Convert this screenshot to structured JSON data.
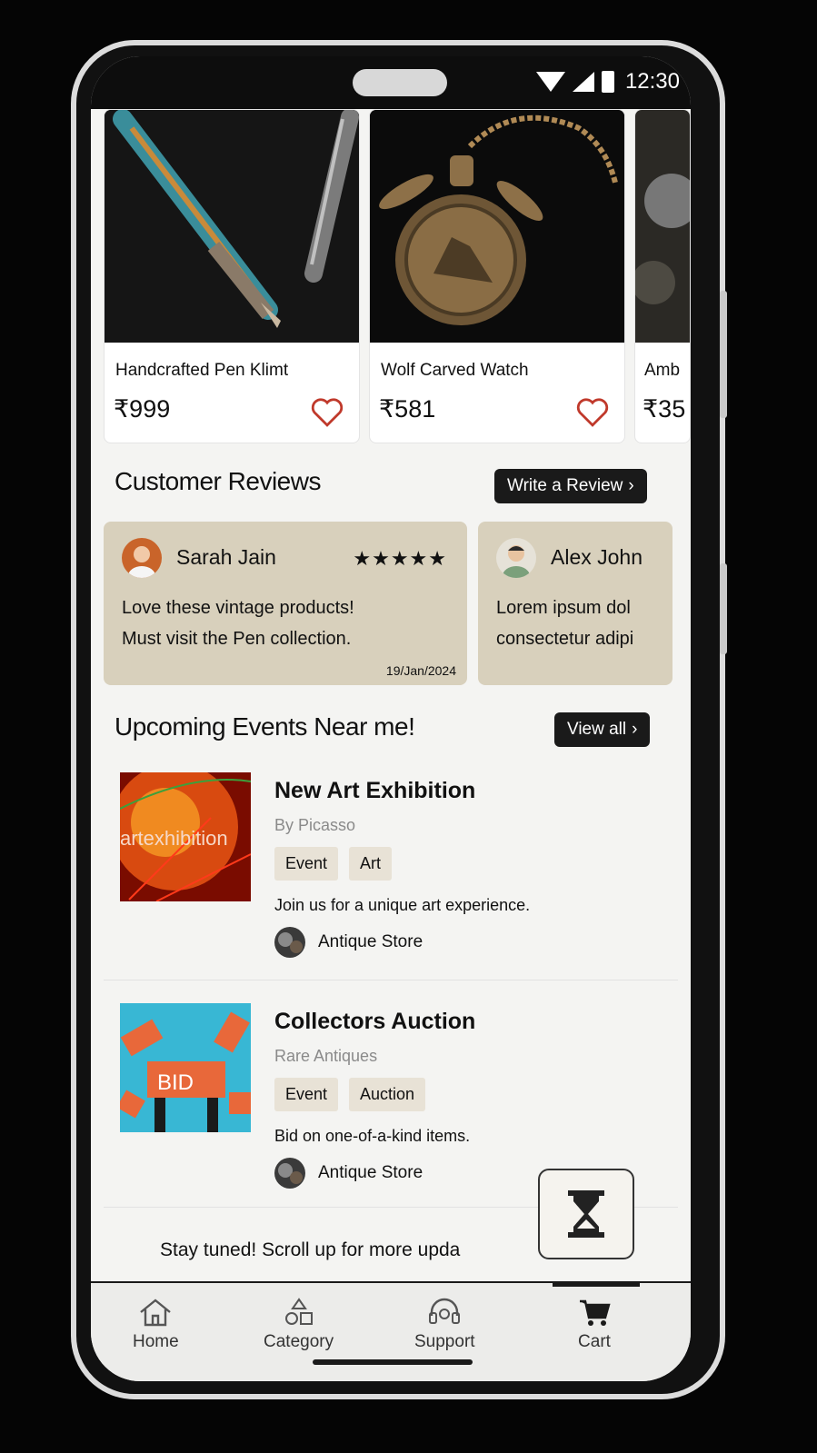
{
  "status": {
    "time": "12:30"
  },
  "products": [
    {
      "name": "Handcrafted Pen Klimt",
      "price": "₹999"
    },
    {
      "name": "Wolf Carved Watch",
      "price": "₹581"
    },
    {
      "name": "Amb",
      "price": "₹35"
    }
  ],
  "reviews_section": {
    "title": "Customer Reviews",
    "button": "Write a Review",
    "items": [
      {
        "name": "Sarah Jain",
        "stars": "★★★★★",
        "line1": "Love these vintage products!",
        "line2": "Must visit the Pen collection.",
        "date": "19/Jan/2024"
      },
      {
        "name": "Alex John",
        "line1": "Lorem ipsum dol",
        "line2": "consectetur adipi"
      }
    ]
  },
  "events_section": {
    "title": "Upcoming Events Near me!",
    "button": "View all",
    "items": [
      {
        "title": "New Art Exhibition",
        "subtitle": "By Picasso",
        "tags": [
          "Event",
          "Art"
        ],
        "description": "Join us for a unique art experience.",
        "store": "Antique Store",
        "image_text": "artexhibition"
      },
      {
        "title": "Collectors Auction",
        "subtitle": "Rare Antiques",
        "tags": [
          "Event",
          "Auction"
        ],
        "description": "Bid on one-of-a-kind items.",
        "store": "Antique Store",
        "image_text": "BID"
      }
    ]
  },
  "footer_text": "Stay tuned! Scroll up for more upda",
  "nav": [
    {
      "label": "Home",
      "icon": "home-icon"
    },
    {
      "label": "Category",
      "icon": "category-icon"
    },
    {
      "label": "Support",
      "icon": "support-icon"
    },
    {
      "label": "Cart",
      "icon": "cart-icon"
    }
  ],
  "colors": {
    "review_card": "#d8d0bc",
    "heart": "#c0392b",
    "button_dark": "#1a1a1a"
  }
}
